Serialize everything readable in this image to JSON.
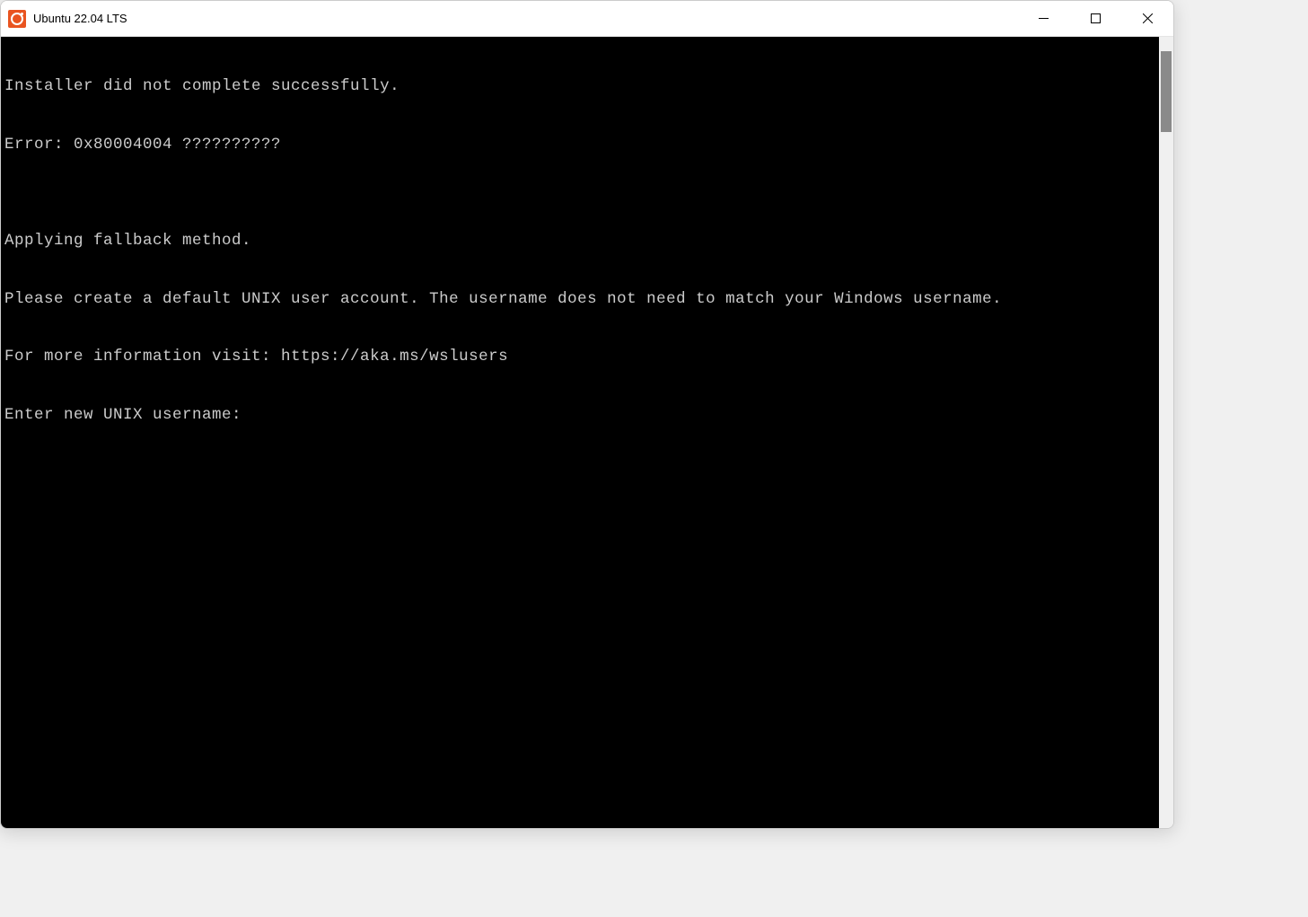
{
  "window": {
    "title": "Ubuntu 22.04 LTS"
  },
  "terminal": {
    "lines": [
      "Installer did not complete successfully.",
      "Error: 0x80004004 ??????????",
      "",
      "Applying fallback method.",
      "Please create a default UNIX user account. The username does not need to match your Windows username.",
      "For more information visit: https://aka.ms/wslusers"
    ],
    "prompt": "Enter new UNIX username: ",
    "input_value": ""
  },
  "icons": {
    "app": "ubuntu-icon",
    "minimize": "minimize-icon",
    "maximize": "maximize-icon",
    "close": "close-icon"
  }
}
